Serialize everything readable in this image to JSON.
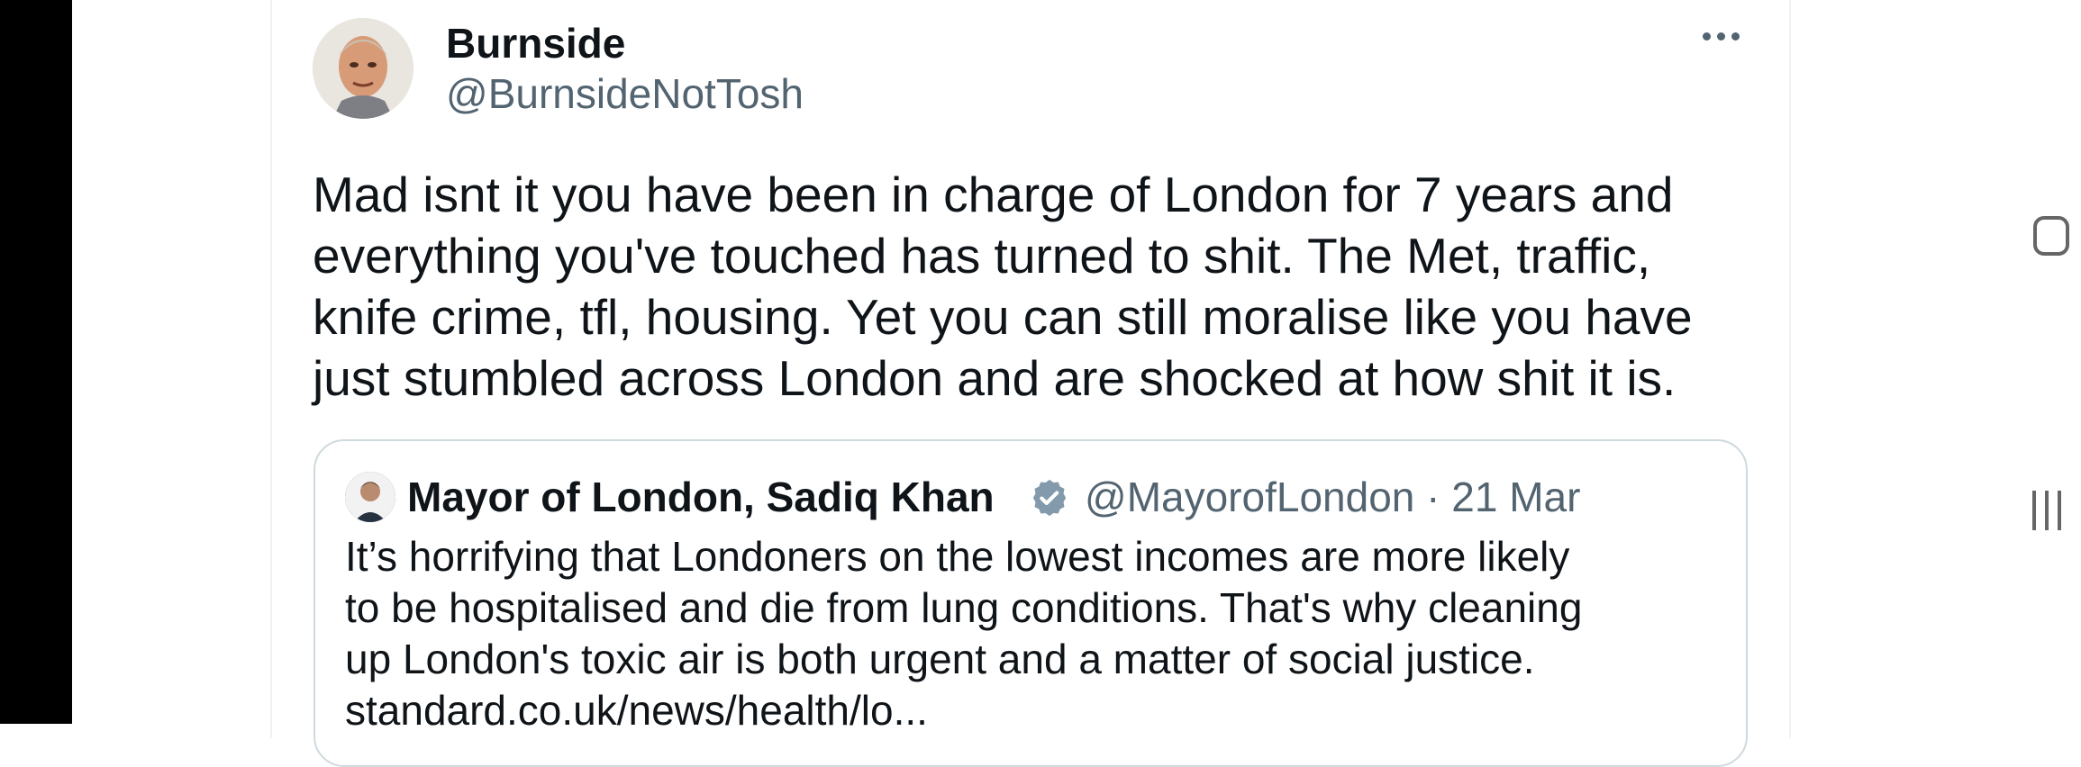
{
  "post": {
    "author_name": "Burnside",
    "author_handle": "@BurnsideNotTosh",
    "text": "Mad isnt it you have been in charge of London for 7 years and\neverything you've touched has turned to shit. The Met, traffic,\nknife crime, tfl, housing. Yet you can still moralise like you have\njust stumbled across London and are shocked at how shit it is."
  },
  "quote": {
    "author_name": "Mayor of London, Sadiq Khan",
    "author_handle": "@MayorofLondon",
    "separator": "·",
    "date": "21 Mar",
    "text": "It’s horrifying that Londoners on the lowest incomes are more likely\nto be hospitalised and die from lung conditions. That's why cleaning\nup London's toxic air is both urgent and a matter of social justice.\nstandard.co.uk/news/health/lo..."
  },
  "icons": {
    "more": "more-options-icon",
    "verified": "verified-badge-icon",
    "nav_overview": "recent-apps-square-icon",
    "nav_recents": "three-lines-icon"
  },
  "colors": {
    "text": "#0f1419",
    "secondary": "#536471",
    "border": "#cfd9de",
    "verified": "#829aab"
  }
}
